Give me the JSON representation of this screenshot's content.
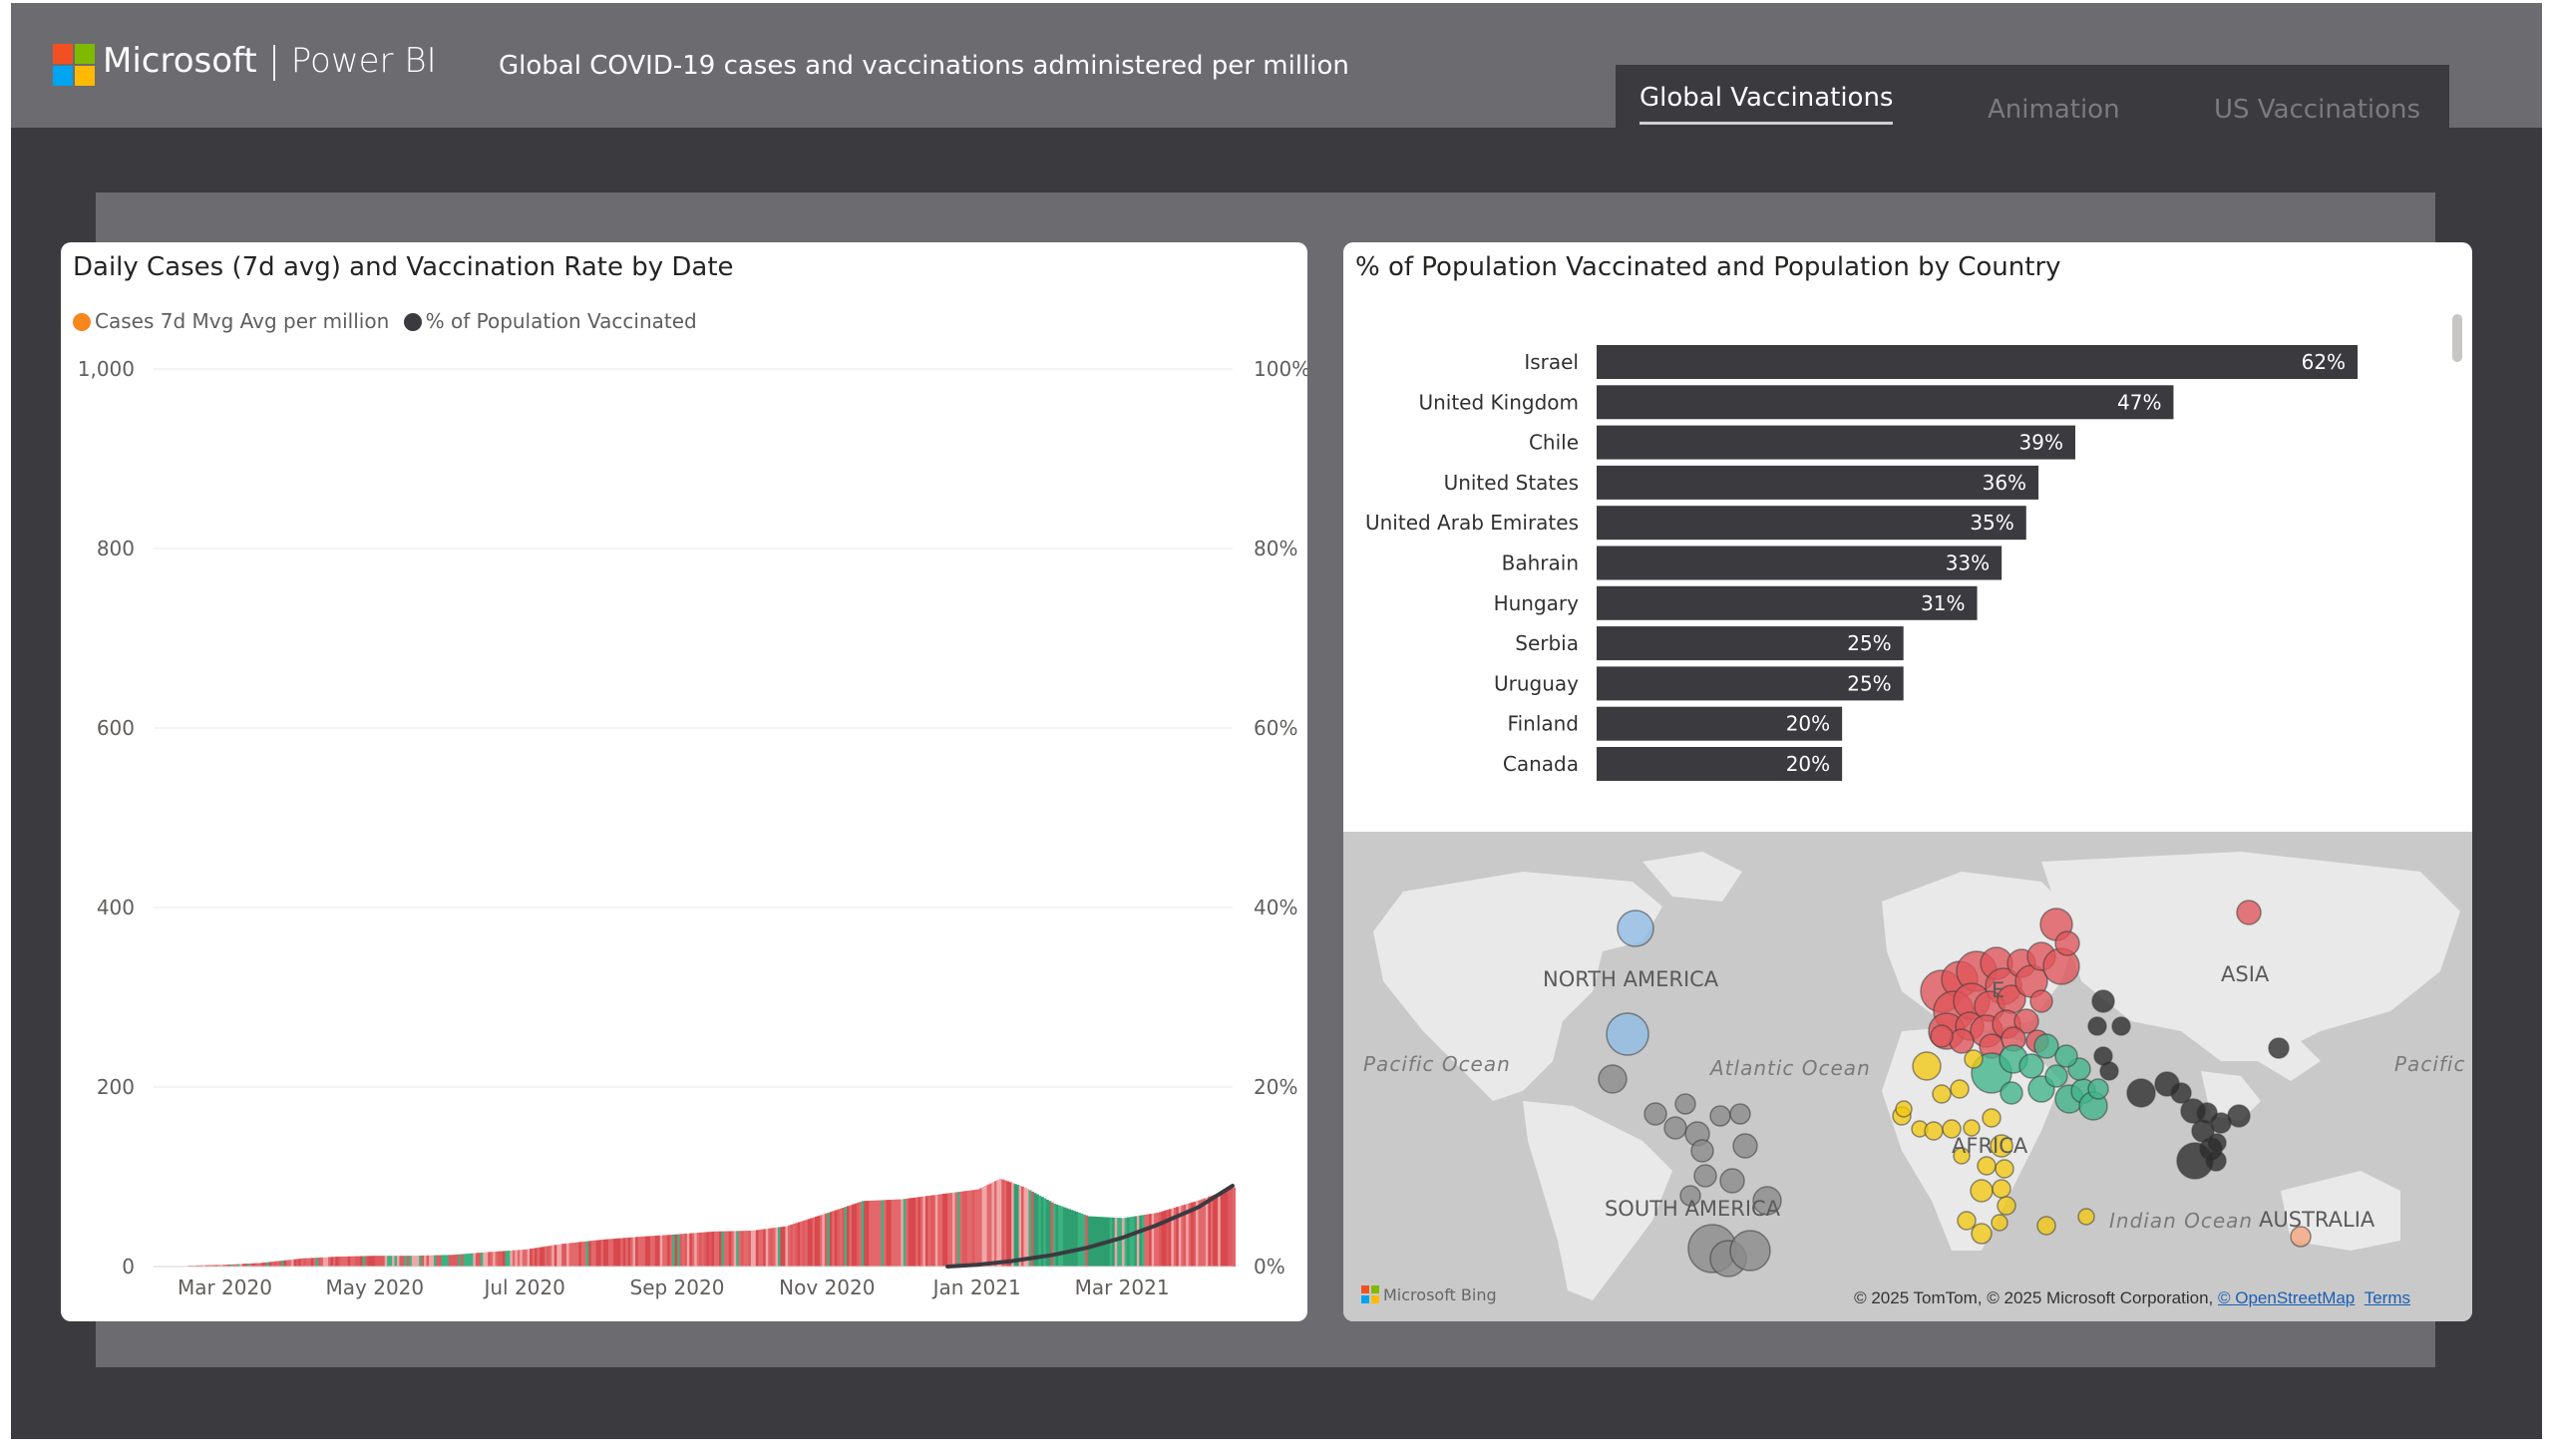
{
  "header": {
    "brand_company": "Microsoft",
    "brand_product": "Power BI",
    "report_title": "Global COVID-19 cases and vaccinations administered per million",
    "logo_colors": [
      "#f25022",
      "#7fba00",
      "#00a4ef",
      "#ffb900"
    ]
  },
  "tabs": [
    {
      "label": "Global Vaccinations",
      "active": true
    },
    {
      "label": "Animation",
      "active": false
    },
    {
      "label": "US Vaccinations",
      "active": false
    }
  ],
  "left_visual": {
    "title": "Daily Cases (7d avg) and Vaccination Rate by Date",
    "legend": [
      {
        "label": "Cases 7d Mvg Avg per million",
        "color": "#f7861c"
      },
      {
        "label": "% of Population Vaccinated",
        "color": "#3b3a3f"
      }
    ]
  },
  "right_visual": {
    "title": "% of Population Vaccinated and Population by Country"
  },
  "map": {
    "labels": {
      "north_america": "NORTH AMERICA",
      "south_america": "SOUTH AMERICA",
      "asia": "ASIA",
      "africa": "AFRICA",
      "europe_fragment": "E",
      "australia": "AUSTRALIA",
      "pacific_left": "Pacific Ocean",
      "pacific_right": "Pacific",
      "atlantic": "Atlantic Ocean",
      "indian": "Indian Ocean"
    },
    "bing_text": "Microsoft Bing",
    "copyright_text": "© 2025 TomTom, © 2025 Microsoft Corporation,",
    "osm_link": "© OpenStreetMap",
    "terms_link": "Terms",
    "region_colors": {
      "americas_north": "#8fbce6",
      "americas_south": "#8a8a8a",
      "europe": "#e0555a",
      "middle_east": "#3fb58a",
      "africa": "#f2c811",
      "asia": "#2b2b2b",
      "oceania": "#f3a47c"
    }
  },
  "chart_data": [
    {
      "type": "bar",
      "orientation": "horizontal",
      "title": "Daily Cases (7d avg) and Vaccination Rate by Date",
      "series_type": "combo: column (cases) + line (% vaccinated)",
      "x_ticks": [
        "Mar 2020",
        "May 2020",
        "Jul 2020",
        "Sep 2020",
        "Nov 2020",
        "Jan 2021",
        "Mar 2021"
      ],
      "y_left": {
        "ticks": [
          "0",
          "200",
          "400",
          "600",
          "800",
          "1,000"
        ],
        "range": [
          0,
          1000
        ]
      },
      "y_right": {
        "ticks": [
          "0%",
          "20%",
          "40%",
          "60%",
          "80%",
          "100%"
        ],
        "range": [
          0,
          100
        ]
      },
      "series": [
        {
          "name": "Cases 7d Mvg Avg per million",
          "x": [
            "2020-02-15",
            "2020-03-01",
            "2020-03-15",
            "2020-04-01",
            "2020-04-15",
            "2020-05-01",
            "2020-05-15",
            "2020-06-01",
            "2020-06-15",
            "2020-07-01",
            "2020-07-15",
            "2020-08-01",
            "2020-08-15",
            "2020-09-01",
            "2020-09-15",
            "2020-10-01",
            "2020-10-15",
            "2020-11-01",
            "2020-11-15",
            "2020-12-01",
            "2020-12-15",
            "2021-01-01",
            "2021-01-10",
            "2021-01-20",
            "2021-02-01",
            "2021-02-15",
            "2021-03-01",
            "2021-03-15",
            "2021-04-01",
            "2021-04-15"
          ],
          "values": [
            1,
            2,
            4,
            9,
            11,
            12,
            12,
            13,
            16,
            19,
            25,
            30,
            33,
            36,
            39,
            40,
            45,
            60,
            73,
            75,
            80,
            86,
            98,
            88,
            70,
            56,
            54,
            60,
            74,
            88
          ]
        },
        {
          "name": "% of Population Vaccinated",
          "x": [
            "2020-12-20",
            "2021-01-01",
            "2021-01-15",
            "2021-02-01",
            "2021-02-15",
            "2021-03-01",
            "2021-03-15",
            "2021-04-01",
            "2021-04-15"
          ],
          "values": [
            0,
            0.2,
            0.6,
            1.3,
            2.1,
            3.2,
            4.6,
            6.6,
            9.0
          ]
        }
      ]
    },
    {
      "type": "bar",
      "title": "% of Population Vaccinated and Population by Country",
      "categories": [
        "Israel",
        "United Kingdom",
        "Chile",
        "United States",
        "United Arab Emirates",
        "Bahrain",
        "Hungary",
        "Serbia",
        "Uruguay",
        "Finland",
        "Canada"
      ],
      "values": [
        62,
        47,
        39,
        36,
        35,
        33,
        31,
        25,
        25,
        20,
        20
      ],
      "value_labels": [
        "62%",
        "47%",
        "39%",
        "36%",
        "35%",
        "33%",
        "31%",
        "25%",
        "25%",
        "20%",
        "20%"
      ],
      "bar_color": "#3b3a3f"
    }
  ]
}
